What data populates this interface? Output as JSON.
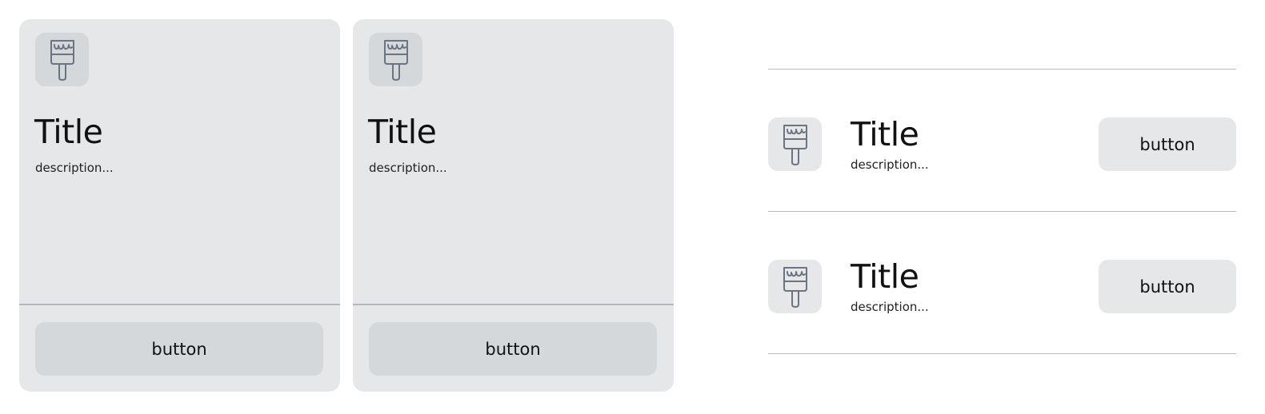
{
  "cards": [
    {
      "icon": "paintbrush-icon",
      "title": "Title",
      "description": "description...",
      "button_label": "button"
    },
    {
      "icon": "paintbrush-icon",
      "title": "Title",
      "description": "description...",
      "button_label": "button"
    }
  ],
  "list": [
    {
      "icon": "paintbrush-icon",
      "title": "Title",
      "description": "description...",
      "button_label": "button"
    },
    {
      "icon": "paintbrush-icon",
      "title": "Title",
      "description": "description...",
      "button_label": "button"
    }
  ],
  "colors": {
    "card_background": "#e6e7e8",
    "icon_tile": "#d5d8db",
    "divider": "#b4b7bd",
    "icon_stroke": "#6b7480"
  }
}
